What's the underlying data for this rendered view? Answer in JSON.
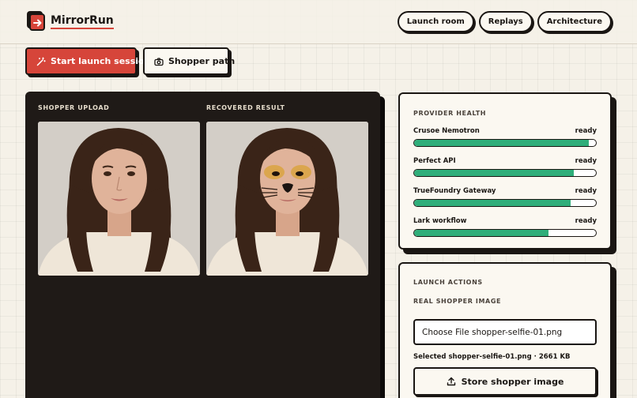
{
  "brand": {
    "name": "MirrorRun"
  },
  "nav": [
    {
      "label": "Launch room"
    },
    {
      "label": "Replays"
    },
    {
      "label": "Architecture"
    }
  ],
  "actions": {
    "primary_label": "Start launch session",
    "secondary_label": "Shopper path"
  },
  "stage": {
    "upload_label": "SHOPPER UPLOAD",
    "result_label": "RECOVERED RESULT"
  },
  "health": {
    "title": "PROVIDER HEALTH",
    "providers": [
      {
        "name": "Crusoe Nemotron",
        "status": "ready",
        "level": 0.96
      },
      {
        "name": "Perfect API",
        "status": "ready",
        "level": 0.88
      },
      {
        "name": "TrueFoundry Gateway",
        "status": "ready",
        "level": 0.86
      },
      {
        "name": "Lark workflow",
        "status": "ready",
        "level": 0.74
      }
    ]
  },
  "launch": {
    "title": "LAUNCH ACTIONS",
    "subtitle": "REAL SHOPPER IMAGE",
    "file_text": "Choose File shopper-selfie-01.png",
    "selected_text": "Selected shopper-selfie-01.png · 2661 KB",
    "store_label": "Store shopper image"
  },
  "colors": {
    "accent": "#d6453a",
    "dark": "#1f1a17",
    "healthy": "#2fae7a",
    "paper": "#fbf8f1"
  }
}
